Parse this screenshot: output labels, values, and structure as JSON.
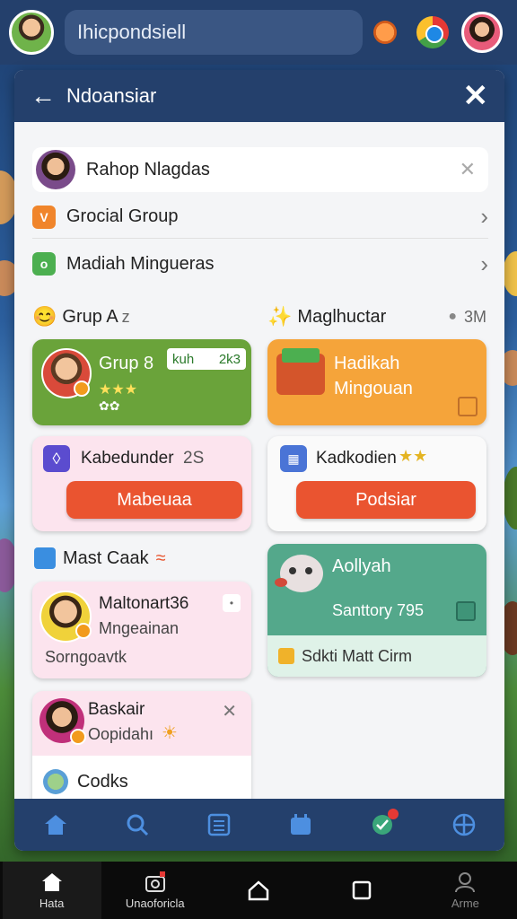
{
  "topbar": {
    "search_text": "Ihicpondsiell"
  },
  "panel": {
    "title": "Ndoansiar",
    "profile_name": "Rahop Nlagdas",
    "menu": [
      {
        "label": "Grocial Group",
        "color": "#f0852b"
      },
      {
        "label": "Madiah Mingueras",
        "color": "#4caf50"
      }
    ],
    "section_left": {
      "label": "Grup A",
      "suffix": "z"
    },
    "section_right": {
      "label": "Maglhuctar",
      "count": "3M"
    },
    "cards": {
      "grup_card": {
        "title": "Grup 8",
        "tag": "kuh",
        "tag_count": "2k3"
      },
      "hadikah_card": {
        "title": "Hadikah",
        "subtitle": "Mingouan"
      },
      "kabedunder_card": {
        "title": "Kabedunder",
        "count": "2S",
        "button": "Mabeuaa"
      },
      "kadkodien_card": {
        "title": "Kadkodien",
        "button": "Podsiar"
      },
      "mast_caak_label": "Mast Caak",
      "maltonart_card": {
        "title": "Maltonart36",
        "line2": "Mngeainan",
        "line3": "Sorngoavtk"
      },
      "aollyah_card": {
        "title": "Aollyah",
        "subtitle": "Santtory 795",
        "footer": "Sdkti Matt Cirm"
      },
      "baskair_card": {
        "title": "Baskair",
        "subtitle": "Oopidahı",
        "footer": "Codks"
      }
    }
  },
  "android_nav": {
    "items": [
      {
        "label": "Hata"
      },
      {
        "label": "Unaoforicla"
      },
      {
        "label": ""
      },
      {
        "label": ""
      },
      {
        "label": "Arme"
      }
    ]
  },
  "colors": {
    "header": "#24406c",
    "accent_red": "#ea5430",
    "card_green": "#6aa33a",
    "card_orange": "#f5a43a",
    "card_teal": "#54a88b"
  }
}
